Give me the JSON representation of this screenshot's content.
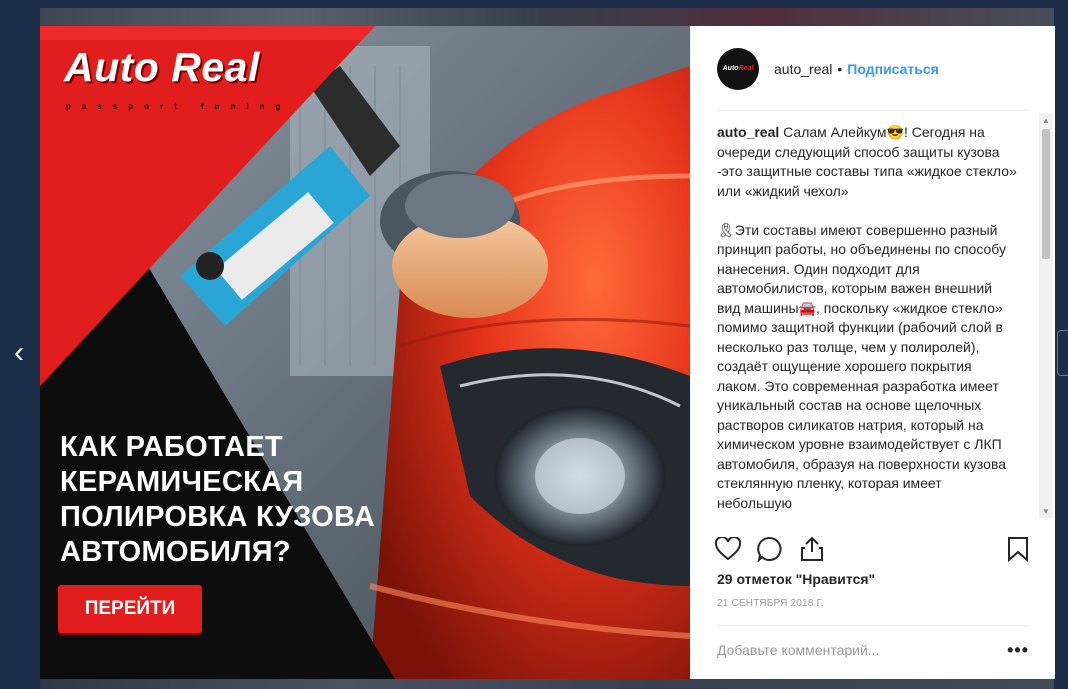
{
  "post": {
    "brand_name": "Auto Real",
    "brand_tagline": "passport tuning",
    "headline_lines": [
      "КАК РАБОТАЕТ",
      "КЕРАМИЧЕСКАЯ",
      "ПОЛИРОВКА КУЗОВА",
      "АВТОМОБИЛЯ?"
    ],
    "cta_label": "ПЕРЕЙТИ"
  },
  "header": {
    "username": "auto_real",
    "separator": "•",
    "follow_label": "Подписаться"
  },
  "caption": {
    "username": "auto_real",
    "paragraphs": [
      "Салам Алейкум😎! Сегодня на очереди следующий способ защиты кузова -это защитные составы типа «жидкое стекло» или «жидкий чехол»",
      "🎗Эти составы имеют совершенно разный принцип работы, но объединены по способу нанесения. Один подходит для автомобилистов, которым важен внешний вид машины🚘, поскольку «жидкое стекло» помимо защитной функции (рабочий слой в несколько раз толще, чем у полиролей), создаёт ощущение хорошего покрытия лаком. Это современная разработка имеет уникальный состав на основе щелочных растворов силикатов натрия, который на химическом уровне взаимодействует с ЛКП автомобиля, образуя на поверхности кузова стеклянную пленку, которая имеет небольшую"
    ]
  },
  "stats": {
    "likes": "29 отметок \"Нравится\"",
    "date": "21 СЕНТЯБРЯ 2018 Г."
  },
  "comment": {
    "placeholder": "Добавьте комментарий...",
    "more_label": "•••"
  },
  "colors": {
    "accent_red": "#e11d1d",
    "link_blue": "#3897f0",
    "text": "#262626",
    "muted": "#999999"
  },
  "icons": {
    "prev": "chevron-left-icon",
    "like": "heart-icon",
    "comment": "comment-icon",
    "share": "share-icon",
    "save": "bookmark-icon"
  }
}
